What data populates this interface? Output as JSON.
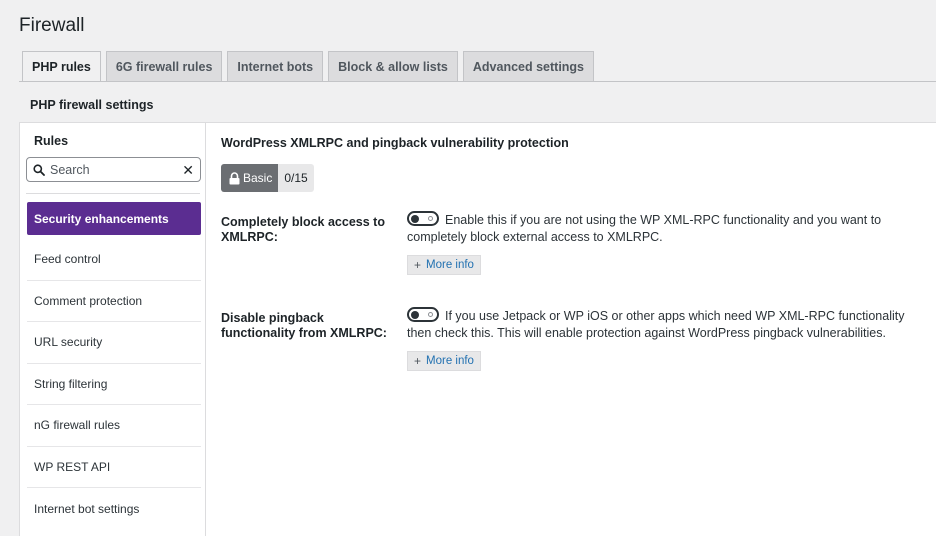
{
  "page": {
    "title": "Firewall"
  },
  "tabs": [
    {
      "label": "PHP rules",
      "active": true
    },
    {
      "label": "6G firewall rules",
      "active": false
    },
    {
      "label": "Internet bots",
      "active": false
    },
    {
      "label": "Block & allow lists",
      "active": false
    },
    {
      "label": "Advanced settings",
      "active": false
    }
  ],
  "section": {
    "heading": "PHP firewall settings"
  },
  "sidebar": {
    "title": "Rules",
    "search": {
      "placeholder": "Search",
      "value": ""
    },
    "items": [
      {
        "label": "Security enhancements",
        "active": true
      },
      {
        "label": "Feed control"
      },
      {
        "label": "Comment protection"
      },
      {
        "label": "URL security"
      },
      {
        "label": "String filtering"
      },
      {
        "label": "nG firewall rules"
      },
      {
        "label": "WP REST API"
      },
      {
        "label": "Internet bot settings"
      }
    ]
  },
  "content": {
    "title": "WordPress XMLRPC and pingback vulnerability protection",
    "level": {
      "label": "Basic",
      "count": "0/15"
    },
    "settings": [
      {
        "label": "Completely block access to XMLRPC:",
        "enabled": false,
        "description": "Enable this if you are not using the WP XML-RPC functionality and you want to completely block external access to XMLRPC.",
        "more_info": "More info"
      },
      {
        "label": "Disable pingback functionality from XMLRPC:",
        "enabled": false,
        "description": "If you use Jetpack or WP iOS or other apps which need WP XML-RPC functionality then check this. This will enable protection against WordPress pingback vulnerabilities.",
        "more_info": "More info"
      }
    ]
  },
  "colors": {
    "accent": "#5b2d91",
    "link": "#2271b1",
    "badge": "#6b6e72"
  }
}
